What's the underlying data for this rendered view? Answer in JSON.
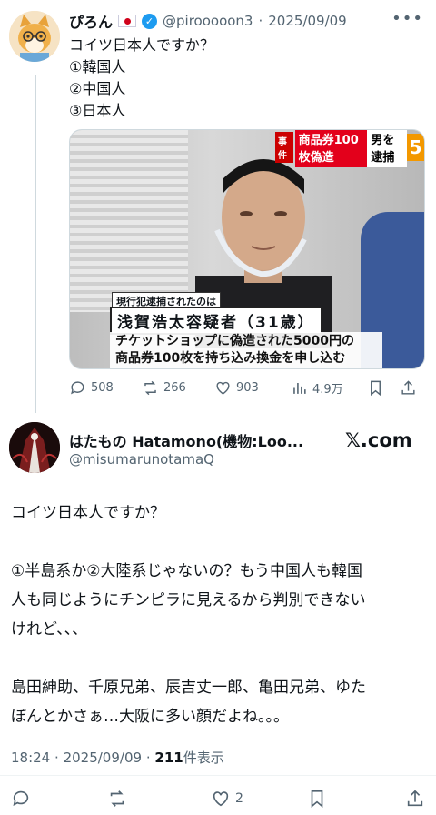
{
  "parent_tweet": {
    "author_name": "ぴろん",
    "handle": "@pirooooon3",
    "separator": "·",
    "date": "2025/09/09",
    "body_lines": [
      "コイツ日本人ですか？",
      "①韓国人",
      "②中国人",
      "③日本人"
    ],
    "media": {
      "news_tag": "事件",
      "headline_red": "商品券100枚偽造",
      "headline_white": "男を逮捕",
      "channel_number": "5",
      "caption_small": "現行犯逮捕されたのは",
      "caption_name": "浅賀浩太容疑者（31歳）",
      "caption_desc_lines": [
        "チケットショップに偽造された5000円の",
        "商品券100枚を持ち込み換金を申し込む"
      ]
    },
    "stats": {
      "replies": "508",
      "reposts": "266",
      "likes": "903",
      "views": "4.9万"
    }
  },
  "main_tweet": {
    "author_name": "はたもの Hatamono(機物:Loo...",
    "handle": "@misumarunotamaQ",
    "site_label": "𝕏.com",
    "body": {
      "line1": "コイツ日本人ですか？",
      "para2": [
        "①半島系か②大陸系じゃないの？もう中国人も韓国",
        "人も同じようにチンピラに見えるから判別できない",
        "けれど、、、"
      ],
      "para3": [
        "島田紳助、千原兄弟、辰吉丈一郎、亀田兄弟、ゆた",
        "ぼんとかさぁ…大阪に多い顔だよね。。。"
      ]
    },
    "time": "18:24",
    "separator": "·",
    "date": "2025/09/09",
    "separator2": "·",
    "view_count": "211",
    "view_label": "件表示",
    "like_count": "2"
  },
  "colors": {
    "text": "#0f1419",
    "muted": "#536471",
    "accent": "#1d9bf0",
    "line": "#cfd9de"
  }
}
